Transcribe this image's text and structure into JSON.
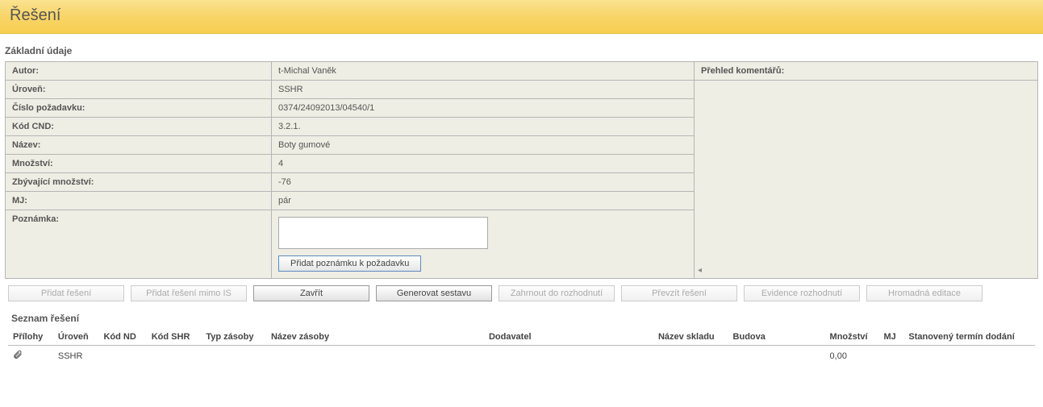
{
  "header": {
    "title": "Řešení"
  },
  "basic": {
    "section_title": "Základní údaje",
    "rows": {
      "autor_label": "Autor:",
      "autor_value": "t-Michal Vaněk",
      "uroven_label": "Úroveň:",
      "uroven_value": "SSHR",
      "cislo_label": "Číslo požadavku:",
      "cislo_value": "0374/24092013/04540/1",
      "kodcnd_label": "Kód CND:",
      "kodcnd_value": "3.2.1.",
      "nazev_label": "Název:",
      "nazev_value": "Boty gumové",
      "mnozstvi_label": "Množství:",
      "mnozstvi_value": "4",
      "zbyv_label": "Zbývající množství:",
      "zbyv_value": "-76",
      "mj_label": "MJ:",
      "mj_value": "pár",
      "poznamka_label": "Poznámka:",
      "poznamka_value": "",
      "poznamka_btn": "Přidat poznámku k požadavku"
    }
  },
  "comments": {
    "header": "Přehled komentářů:"
  },
  "buttons": {
    "pridat_reseni": "Přidat řešení",
    "pridat_reseni_mimo": "Přidat řešení mimo IS",
    "zavrit": "Zavřít",
    "generovat": "Generovat sestavu",
    "zahrnout": "Zahrnout do rozhodnutí",
    "prevzit": "Převzít řešení",
    "evidence": "Evidence rozhodnutí",
    "hromadna": "Hromadná editace"
  },
  "solutions": {
    "title": "Seznam řešení",
    "columns": {
      "prilohy": "Přílohy",
      "uroven": "Úroveň",
      "kodnd": "Kód ND",
      "kodshr": "Kód SHR",
      "typzasoby": "Typ zásoby",
      "nazevzasoby": "Název zásoby",
      "dodavatel": "Dodavatel",
      "nazevskladu": "Název skladu",
      "budova": "Budova",
      "mnozstvi": "Množství",
      "mj": "MJ",
      "termin": "Stanovený termín dodání"
    },
    "rows": [
      {
        "has_attachment": true,
        "uroven": "SSHR",
        "kodnd": "",
        "kodshr": "",
        "typzasoby": "",
        "nazevzasoby": "",
        "dodavatel": "",
        "nazevskladu": "",
        "budova": "",
        "mnozstvi": "0,00",
        "mj": "",
        "termin": ""
      }
    ]
  }
}
